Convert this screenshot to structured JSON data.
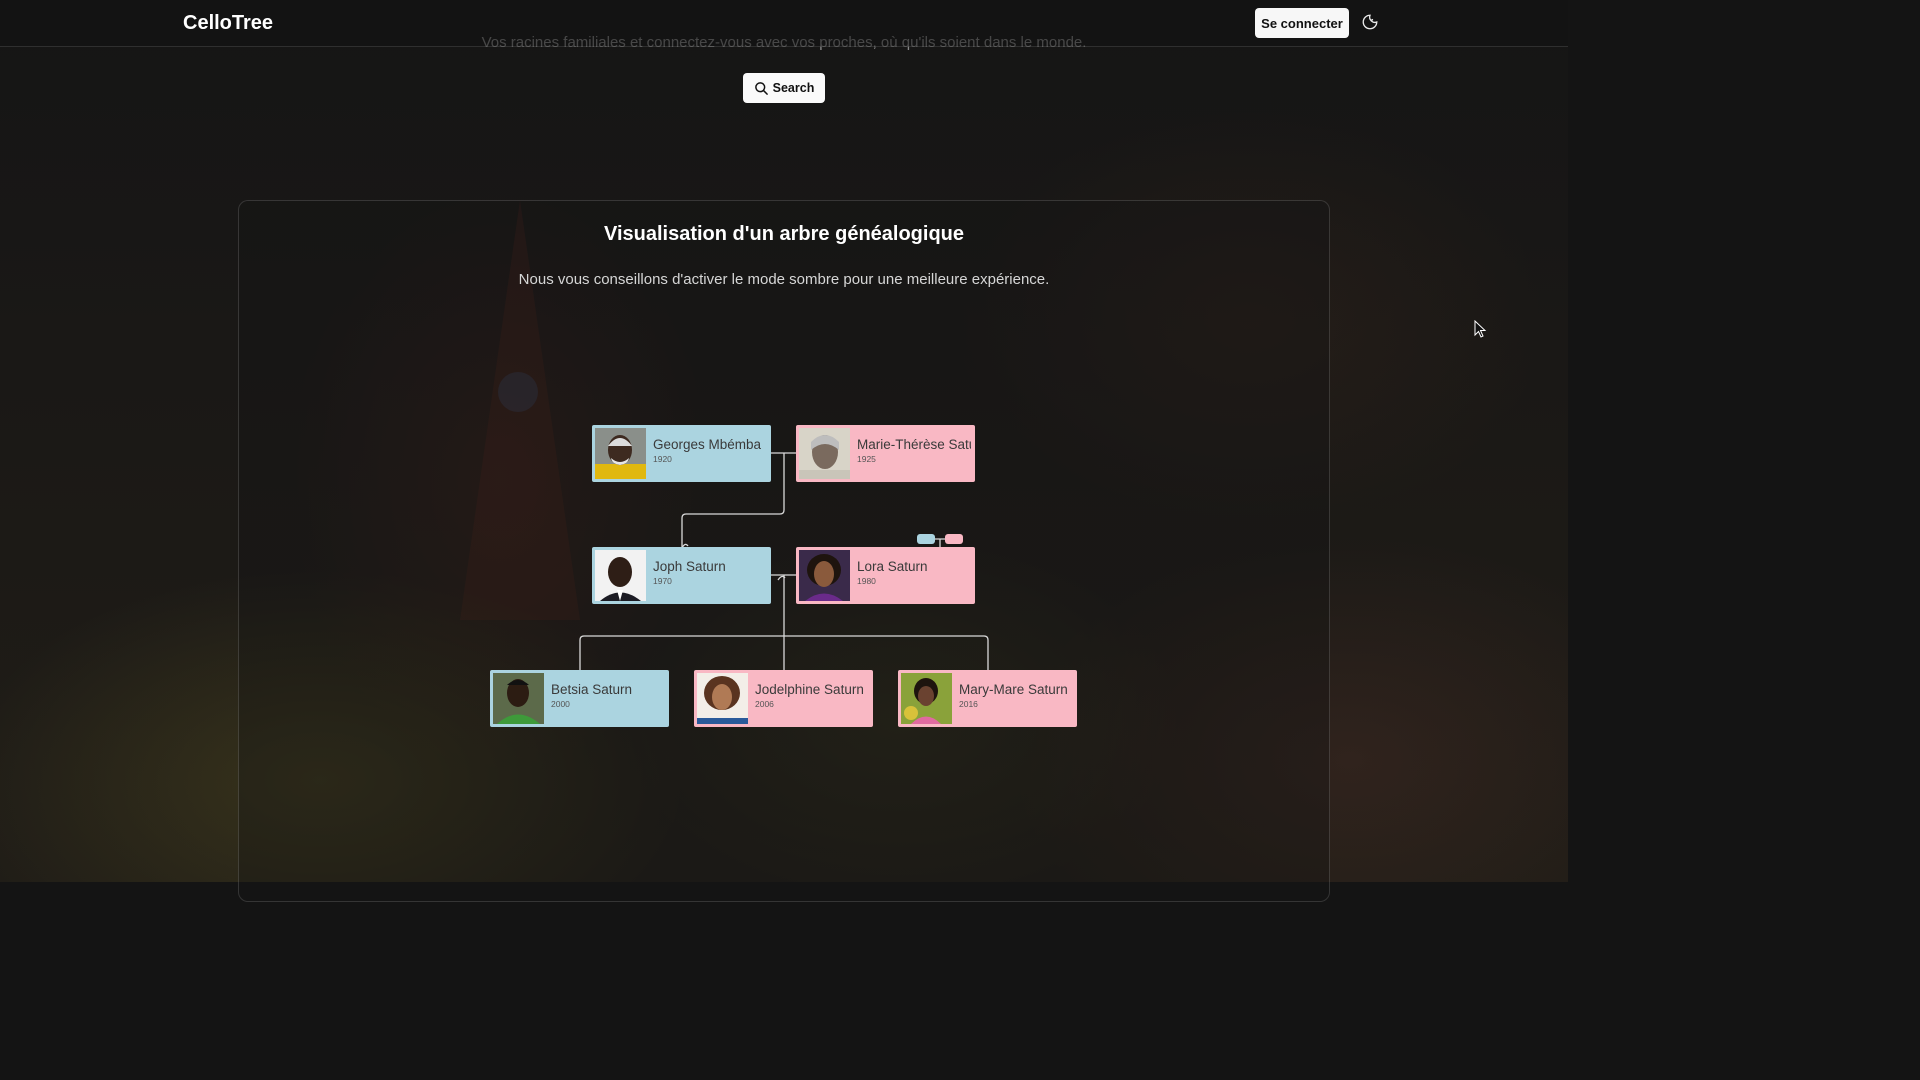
{
  "header": {
    "brand": "CelloTree",
    "login_label": "Se connecter",
    "theme_toggle_icon": "moon-sun-icon"
  },
  "hero": {
    "tagline": "Vos racines familiales et connectez-vous avec vos proches, où qu'ils soient dans le monde.",
    "search_label": "Search",
    "search_icon": "search-icon"
  },
  "panel": {
    "title": "Visualisation d'un arbre généalogique",
    "subtitle": "Nous vous conseillons d'activer le mode sombre pour une meilleure expérience."
  },
  "colors": {
    "male_card": "#abd4e0",
    "female_card": "#f9b8c4",
    "line": "#d9d9d9",
    "background": "#141414"
  },
  "tree": {
    "people": [
      {
        "id": "georges",
        "name": "Georges Mbémba",
        "year": "1920",
        "gender": "male"
      },
      {
        "id": "marie",
        "name": "Marie-Thérèse Saturn",
        "year": "1925",
        "gender": "female"
      },
      {
        "id": "joph",
        "name": "Joph Saturn",
        "year": "1970",
        "gender": "male"
      },
      {
        "id": "lora",
        "name": "Lora Saturn",
        "year": "1980",
        "gender": "female"
      },
      {
        "id": "betsia",
        "name": "Betsia Saturn",
        "year": "2000",
        "gender": "male"
      },
      {
        "id": "jodelphine",
        "name": "Jodelphine Saturn",
        "year": "2006",
        "gender": "female"
      },
      {
        "id": "marymare",
        "name": "Mary-Mare Saturn",
        "year": "2016",
        "gender": "female"
      }
    ]
  }
}
